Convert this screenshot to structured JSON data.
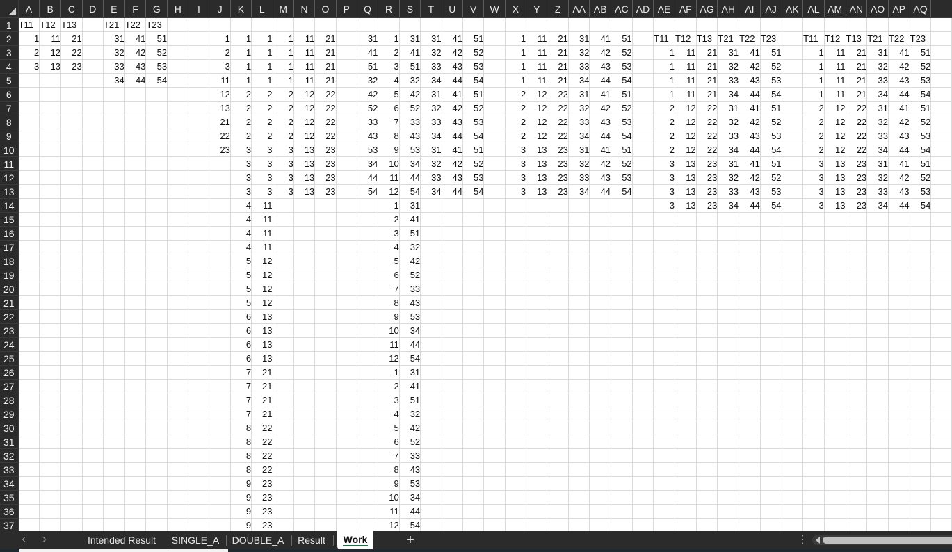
{
  "columns": [
    "A",
    "B",
    "C",
    "D",
    "E",
    "F",
    "G",
    "H",
    "I",
    "J",
    "K",
    "L",
    "M",
    "N",
    "O",
    "P",
    "Q",
    "R",
    "S",
    "T",
    "U",
    "V",
    "W",
    "X",
    "Y",
    "Z",
    "AA",
    "AB",
    "AC",
    "AD",
    "AE",
    "AF",
    "AG",
    "AH",
    "AI",
    "AJ",
    "AK",
    "AL",
    "AM",
    "AN",
    "AO",
    "AP",
    "AQ"
  ],
  "row_count": 37,
  "rows": {
    "1": {
      "A": "T11",
      "B": "T12",
      "C": "T13",
      "E": "T21",
      "F": "T22",
      "G": "T23"
    },
    "2": {
      "A": 1,
      "B": 11,
      "C": 21,
      "E": 31,
      "F": 41,
      "G": 51,
      "J": 1,
      "K": 1,
      "L": 1,
      "M": 1,
      "N": 11,
      "O": 21,
      "Q": 31,
      "R": 1,
      "S": 31,
      "T": 31,
      "U": 41,
      "V": 51,
      "X": 1,
      "Y": 11,
      "Z": 21,
      "AA": 31,
      "AB": 41,
      "AC": 51,
      "AE": "T11",
      "AF": "T12",
      "AG": "T13",
      "AH": "T21",
      "AI": "T22",
      "AJ": "T23",
      "AL": "T11",
      "AM": "T12",
      "AN": "T13",
      "AO": "T21",
      "AP": "T22",
      "AQ": "T23"
    },
    "3": {
      "A": 2,
      "B": 12,
      "C": 22,
      "E": 32,
      "F": 42,
      "G": 52,
      "J": 2,
      "K": 1,
      "L": 1,
      "M": 1,
      "N": 11,
      "O": 21,
      "Q": 41,
      "R": 2,
      "S": 41,
      "T": 32,
      "U": 42,
      "V": 52,
      "X": 1,
      "Y": 11,
      "Z": 21,
      "AA": 32,
      "AB": 42,
      "AC": 52,
      "AE": 1,
      "AF": 11,
      "AG": 21,
      "AH": 31,
      "AI": 41,
      "AJ": 51,
      "AL": 1,
      "AM": 11,
      "AN": 21,
      "AO": 31,
      "AP": 41,
      "AQ": 51
    },
    "4": {
      "A": 3,
      "B": 13,
      "C": 23,
      "E": 33,
      "F": 43,
      "G": 53,
      "J": 3,
      "K": 1,
      "L": 1,
      "M": 1,
      "N": 11,
      "O": 21,
      "Q": 51,
      "R": 3,
      "S": 51,
      "T": 33,
      "U": 43,
      "V": 53,
      "X": 1,
      "Y": 11,
      "Z": 21,
      "AA": 33,
      "AB": 43,
      "AC": 53,
      "AE": 1,
      "AF": 11,
      "AG": 21,
      "AH": 32,
      "AI": 42,
      "AJ": 52,
      "AL": 1,
      "AM": 11,
      "AN": 21,
      "AO": 32,
      "AP": 42,
      "AQ": 52
    },
    "5": {
      "E": 34,
      "F": 44,
      "G": 54,
      "J": 11,
      "K": 1,
      "L": 1,
      "M": 1,
      "N": 11,
      "O": 21,
      "Q": 32,
      "R": 4,
      "S": 32,
      "T": 34,
      "U": 44,
      "V": 54,
      "X": 1,
      "Y": 11,
      "Z": 21,
      "AA": 34,
      "AB": 44,
      "AC": 54,
      "AE": 1,
      "AF": 11,
      "AG": 21,
      "AH": 33,
      "AI": 43,
      "AJ": 53,
      "AL": 1,
      "AM": 11,
      "AN": 21,
      "AO": 33,
      "AP": 43,
      "AQ": 53
    },
    "6": {
      "J": 12,
      "K": 2,
      "L": 2,
      "M": 2,
      "N": 12,
      "O": 22,
      "Q": 42,
      "R": 5,
      "S": 42,
      "T": 31,
      "U": 41,
      "V": 51,
      "X": 2,
      "Y": 12,
      "Z": 22,
      "AA": 31,
      "AB": 41,
      "AC": 51,
      "AE": 1,
      "AF": 11,
      "AG": 21,
      "AH": 34,
      "AI": 44,
      "AJ": 54,
      "AL": 1,
      "AM": 11,
      "AN": 21,
      "AO": 34,
      "AP": 44,
      "AQ": 54
    },
    "7": {
      "J": 13,
      "K": 2,
      "L": 2,
      "M": 2,
      "N": 12,
      "O": 22,
      "Q": 52,
      "R": 6,
      "S": 52,
      "T": 32,
      "U": 42,
      "V": 52,
      "X": 2,
      "Y": 12,
      "Z": 22,
      "AA": 32,
      "AB": 42,
      "AC": 52,
      "AE": 2,
      "AF": 12,
      "AG": 22,
      "AH": 31,
      "AI": 41,
      "AJ": 51,
      "AL": 2,
      "AM": 12,
      "AN": 22,
      "AO": 31,
      "AP": 41,
      "AQ": 51
    },
    "8": {
      "J": 21,
      "K": 2,
      "L": 2,
      "M": 2,
      "N": 12,
      "O": 22,
      "Q": 33,
      "R": 7,
      "S": 33,
      "T": 33,
      "U": 43,
      "V": 53,
      "X": 2,
      "Y": 12,
      "Z": 22,
      "AA": 33,
      "AB": 43,
      "AC": 53,
      "AE": 2,
      "AF": 12,
      "AG": 22,
      "AH": 32,
      "AI": 42,
      "AJ": 52,
      "AL": 2,
      "AM": 12,
      "AN": 22,
      "AO": 32,
      "AP": 42,
      "AQ": 52
    },
    "9": {
      "J": 22,
      "K": 2,
      "L": 2,
      "M": 2,
      "N": 12,
      "O": 22,
      "Q": 43,
      "R": 8,
      "S": 43,
      "T": 34,
      "U": 44,
      "V": 54,
      "X": 2,
      "Y": 12,
      "Z": 22,
      "AA": 34,
      "AB": 44,
      "AC": 54,
      "AE": 2,
      "AF": 12,
      "AG": 22,
      "AH": 33,
      "AI": 43,
      "AJ": 53,
      "AL": 2,
      "AM": 12,
      "AN": 22,
      "AO": 33,
      "AP": 43,
      "AQ": 53
    },
    "10": {
      "J": 23,
      "K": 3,
      "L": 3,
      "M": 3,
      "N": 13,
      "O": 23,
      "Q": 53,
      "R": 9,
      "S": 53,
      "T": 31,
      "U": 41,
      "V": 51,
      "X": 3,
      "Y": 13,
      "Z": 23,
      "AA": 31,
      "AB": 41,
      "AC": 51,
      "AE": 2,
      "AF": 12,
      "AG": 22,
      "AH": 34,
      "AI": 44,
      "AJ": 54,
      "AL": 2,
      "AM": 12,
      "AN": 22,
      "AO": 34,
      "AP": 44,
      "AQ": 54
    },
    "11": {
      "K": 3,
      "L": 3,
      "M": 3,
      "N": 13,
      "O": 23,
      "Q": 34,
      "R": 10,
      "S": 34,
      "T": 32,
      "U": 42,
      "V": 52,
      "X": 3,
      "Y": 13,
      "Z": 23,
      "AA": 32,
      "AB": 42,
      "AC": 52,
      "AE": 3,
      "AF": 13,
      "AG": 23,
      "AH": 31,
      "AI": 41,
      "AJ": 51,
      "AL": 3,
      "AM": 13,
      "AN": 23,
      "AO": 31,
      "AP": 41,
      "AQ": 51
    },
    "12": {
      "K": 3,
      "L": 3,
      "M": 3,
      "N": 13,
      "O": 23,
      "Q": 44,
      "R": 11,
      "S": 44,
      "T": 33,
      "U": 43,
      "V": 53,
      "X": 3,
      "Y": 13,
      "Z": 23,
      "AA": 33,
      "AB": 43,
      "AC": 53,
      "AE": 3,
      "AF": 13,
      "AG": 23,
      "AH": 32,
      "AI": 42,
      "AJ": 52,
      "AL": 3,
      "AM": 13,
      "AN": 23,
      "AO": 32,
      "AP": 42,
      "AQ": 52
    },
    "13": {
      "K": 3,
      "L": 3,
      "M": 3,
      "N": 13,
      "O": 23,
      "Q": 54,
      "R": 12,
      "S": 54,
      "T": 34,
      "U": 44,
      "V": 54,
      "X": 3,
      "Y": 13,
      "Z": 23,
      "AA": 34,
      "AB": 44,
      "AC": 54,
      "AE": 3,
      "AF": 13,
      "AG": 23,
      "AH": 33,
      "AI": 43,
      "AJ": 53,
      "AL": 3,
      "AM": 13,
      "AN": 23,
      "AO": 33,
      "AP": 43,
      "AQ": 53
    },
    "14": {
      "K": 4,
      "L": 11,
      "R": 1,
      "S": 31,
      "AE": 3,
      "AF": 13,
      "AG": 23,
      "AH": 34,
      "AI": 44,
      "AJ": 54,
      "AL": 3,
      "AM": 13,
      "AN": 23,
      "AO": 34,
      "AP": 44,
      "AQ": 54
    },
    "15": {
      "K": 4,
      "L": 11,
      "R": 2,
      "S": 41
    },
    "16": {
      "K": 4,
      "L": 11,
      "R": 3,
      "S": 51
    },
    "17": {
      "K": 4,
      "L": 11,
      "R": 4,
      "S": 32
    },
    "18": {
      "K": 5,
      "L": 12,
      "R": 5,
      "S": 42
    },
    "19": {
      "K": 5,
      "L": 12,
      "R": 6,
      "S": 52
    },
    "20": {
      "K": 5,
      "L": 12,
      "R": 7,
      "S": 33
    },
    "21": {
      "K": 5,
      "L": 12,
      "R": 8,
      "S": 43
    },
    "22": {
      "K": 6,
      "L": 13,
      "R": 9,
      "S": 53
    },
    "23": {
      "K": 6,
      "L": 13,
      "R": 10,
      "S": 34
    },
    "24": {
      "K": 6,
      "L": 13,
      "R": 11,
      "S": 44
    },
    "25": {
      "K": 6,
      "L": 13,
      "R": 12,
      "S": 54
    },
    "26": {
      "K": 7,
      "L": 21,
      "R": 1,
      "S": 31
    },
    "27": {
      "K": 7,
      "L": 21,
      "R": 2,
      "S": 41
    },
    "28": {
      "K": 7,
      "L": 21,
      "R": 3,
      "S": 51
    },
    "29": {
      "K": 7,
      "L": 21,
      "R": 4,
      "S": 32
    },
    "30": {
      "K": 8,
      "L": 22,
      "R": 5,
      "S": 42
    },
    "31": {
      "K": 8,
      "L": 22,
      "R": 6,
      "S": 52
    },
    "32": {
      "K": 8,
      "L": 22,
      "R": 7,
      "S": 33
    },
    "33": {
      "K": 8,
      "L": 22,
      "R": 8,
      "S": 43
    },
    "34": {
      "K": 9,
      "L": 23,
      "R": 9,
      "S": 53
    },
    "35": {
      "K": 9,
      "L": 23,
      "R": 10,
      "S": 34
    },
    "36": {
      "K": 9,
      "L": 23,
      "R": 11,
      "S": 44
    },
    "37": {
      "K": 9,
      "L": 23,
      "R": 12,
      "S": 54
    }
  },
  "tabs": [
    {
      "label": "Intended Result",
      "active": false
    },
    {
      "label": "SINGLE_A",
      "active": false
    },
    {
      "label": "DOUBLE_A",
      "active": false
    },
    {
      "label": "Result",
      "active": false
    },
    {
      "label": "Work",
      "active": true
    }
  ],
  "tabbar": {
    "prev_icon": "‹",
    "next_icon": "›",
    "add_sheet_icon": "+",
    "more_icon": "⋮",
    "accent_color": "#1e7145"
  }
}
